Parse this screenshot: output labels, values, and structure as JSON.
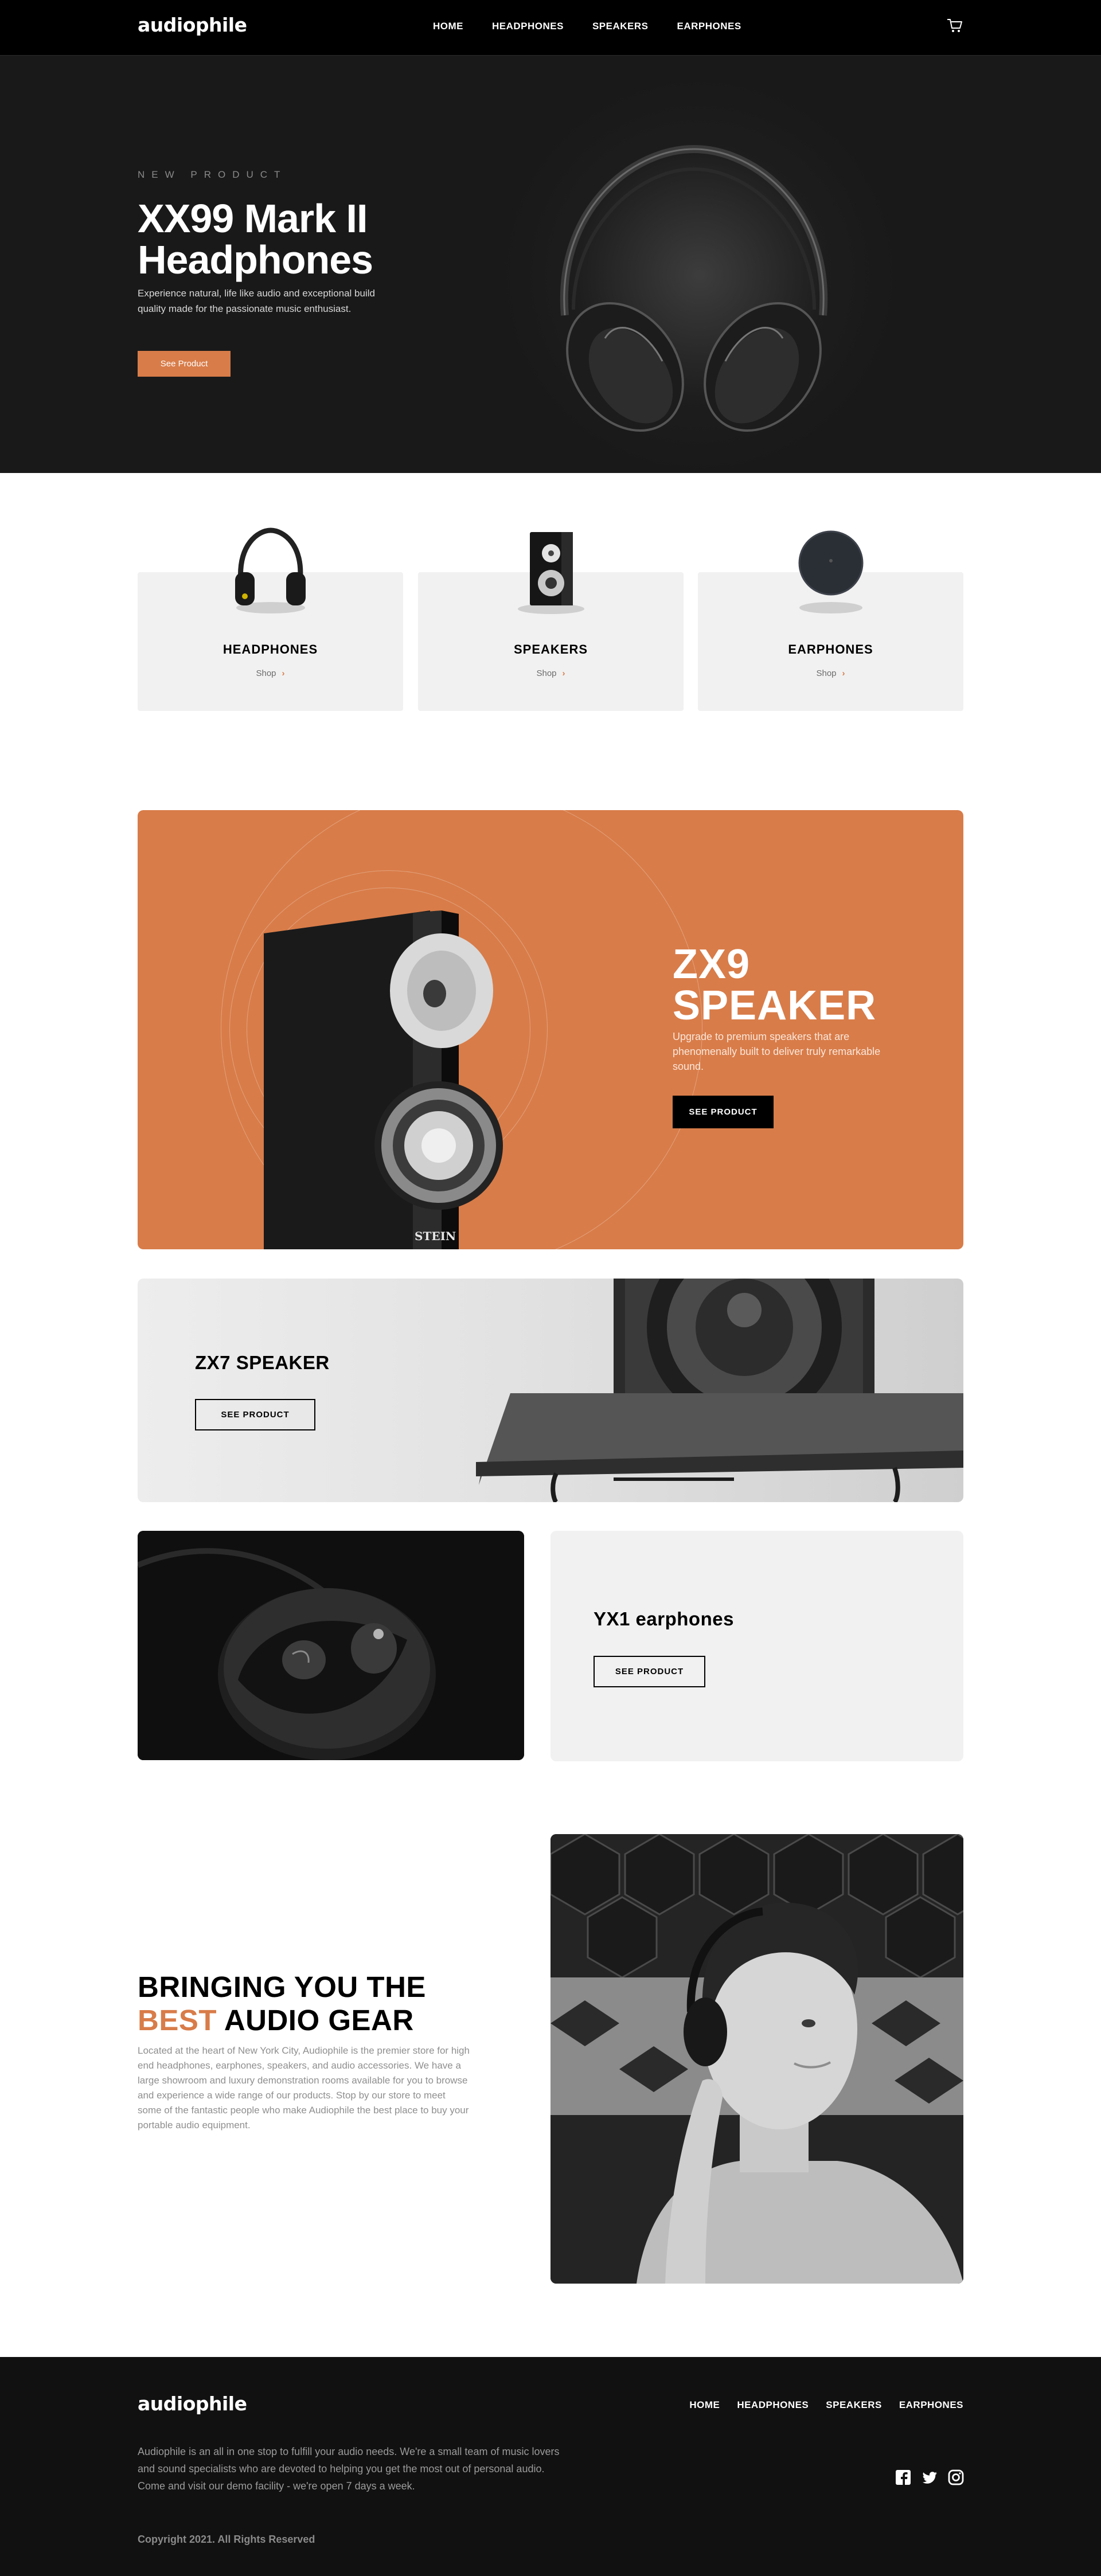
{
  "brand": {
    "logo": "audiophile",
    "accent_color": "#d87d4a"
  },
  "nav": {
    "links": [
      "HOME",
      "HEADPHONES",
      "SPEAKERS",
      "EARPHONES"
    ],
    "cart_icon": "cart-icon"
  },
  "hero": {
    "overline": "NEW PRODUCT",
    "title": "XX99 Mark II Headphones",
    "description": "Experience natural, life like audio and exceptional build quality made for the passionate music enthusiast.",
    "button": "See Product"
  },
  "categories": [
    {
      "title": "HEADPHONES",
      "shop": "Shop"
    },
    {
      "title": "SPEAKERS",
      "shop": "Shop"
    },
    {
      "title": "EARPHONES",
      "shop": "Shop"
    }
  ],
  "zx9": {
    "title": "ZX9 SPEAKER",
    "description": "Upgrade to premium speakers that are phenomenally built to deliver truly remarkable sound.",
    "button": "SEE PRODUCT",
    "speaker_brand": "STEIN"
  },
  "zx7": {
    "title": "ZX7 SPEAKER",
    "button": "SEE PRODUCT"
  },
  "yx1": {
    "title": "YX1 earphones",
    "button": "SEE PRODUCT"
  },
  "about": {
    "title_start": "BRINGING YOU THE",
    "title_accent": "BEST",
    "title_end": "AUDIO GEAR",
    "description": "Located at the heart of New York City, Audiophile is the premier store for high end headphones, earphones, speakers, and audio accessories. We have a large showroom and luxury demonstration rooms available for you to browse and experience a wide range of our products. Stop by our store to meet some of the fantastic people who make Audiophile the best place to buy your portable audio equipment."
  },
  "footer": {
    "logo": "audiophile",
    "links": [
      "HOME",
      "HEADPHONES",
      "SPEAKERS",
      "EARPHONES"
    ],
    "description": "Audiophile is an all in one stop to fulfill your audio needs. We're a small team of music lovers and sound specialists who are devoted to helping you get the most out of personal audio. Come and visit our demo facility - we're open 7 days a week.",
    "copyright": "Copyright 2021. All Rights Reserved",
    "socials": [
      "facebook-icon",
      "twitter-icon",
      "instagram-icon"
    ]
  }
}
